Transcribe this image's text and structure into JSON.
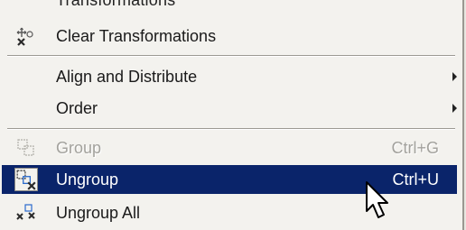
{
  "menu": {
    "partial_item_label": "Transformations",
    "items": [
      {
        "label": "Clear Transformations",
        "shortcut": "",
        "icon": "clear-transform-icon",
        "disabled": false,
        "selected": false,
        "submenu": false
      },
      {
        "label": "Align and Distribute",
        "shortcut": "",
        "icon": "",
        "disabled": false,
        "selected": false,
        "submenu": true
      },
      {
        "label": "Order",
        "shortcut": "",
        "icon": "",
        "disabled": false,
        "selected": false,
        "submenu": true
      },
      {
        "label": "Group",
        "shortcut": "Ctrl+G",
        "icon": "group-icon",
        "disabled": true,
        "selected": false,
        "submenu": false
      },
      {
        "label": "Ungroup",
        "shortcut": "Ctrl+U",
        "icon": "ungroup-icon",
        "disabled": false,
        "selected": true,
        "submenu": false
      },
      {
        "label": "Ungroup All",
        "shortcut": "",
        "icon": "ungroup-all-icon",
        "disabled": false,
        "selected": false,
        "submenu": false
      }
    ]
  },
  "colors": {
    "menu_bg": "#f3f2ee",
    "highlight": "#0a246a",
    "disabled_text": "#a3a29d"
  }
}
